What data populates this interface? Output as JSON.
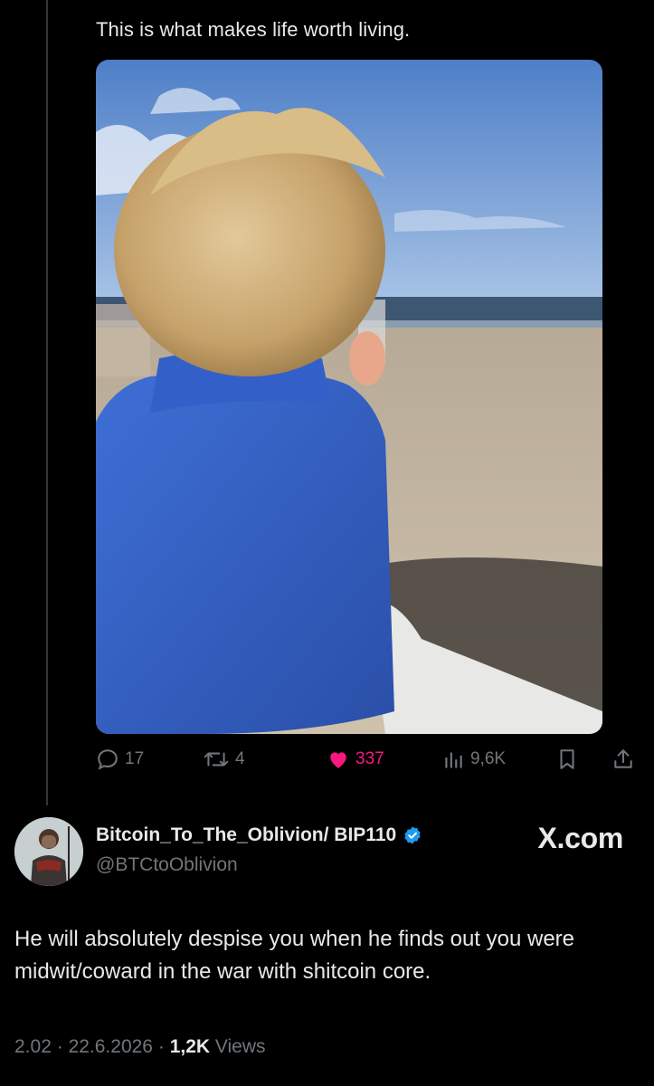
{
  "quoted_post": {
    "text": "This is what makes life worth living.",
    "image_description_icon": "photo-child-at-beach",
    "actions": {
      "replies": "17",
      "reposts": "4",
      "likes": "337",
      "views": "9,6K"
    }
  },
  "post": {
    "author_name": "Bitcoin_To_The_Oblivion/ BIP110",
    "handle": "@BTCtoOblivion",
    "verified": true,
    "brand": "X.com",
    "text": "He will absolutely despise you when he finds out you were midwit/coward in the war with shitcoin core.",
    "time": "2.02",
    "date": "22.6.2026",
    "views_count": "1,2K",
    "views_label": "Views",
    "separator": "·"
  },
  "colors": {
    "background": "#000000",
    "text_primary": "#e7e9ea",
    "text_secondary": "#71767b",
    "like_pink": "#f91880",
    "verified_blue": "#1d9bf0"
  }
}
